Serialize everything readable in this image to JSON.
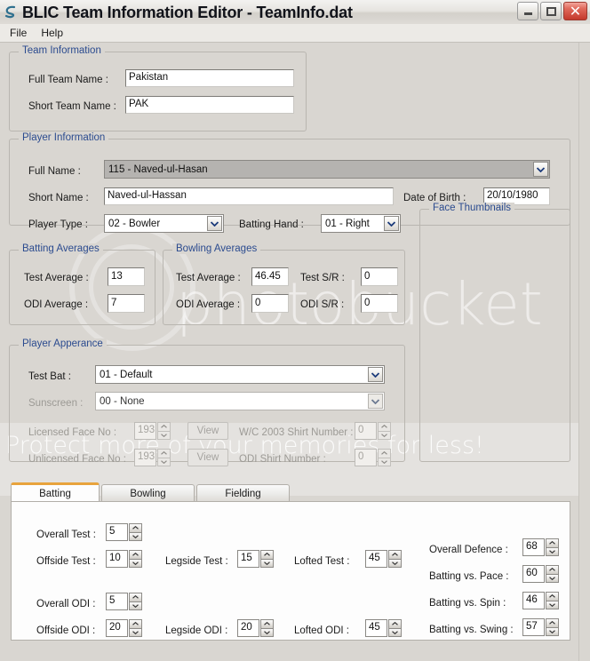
{
  "window": {
    "title": "BLIC Team Information Editor - TeamInfo.dat",
    "minimize_label": "Minimize",
    "maximize_label": "Maximize",
    "close_label": "✕"
  },
  "menu": {
    "items": [
      {
        "label": "File"
      },
      {
        "label": "Help"
      }
    ]
  },
  "team_information": {
    "title": "Team Information",
    "full_team_name_label": "Full Team Name :",
    "full_team_name_value": "Pakistan",
    "short_team_name_label": "Short Team Name :",
    "short_team_name_value": "PAK"
  },
  "player_information": {
    "title": "Player Information",
    "full_name_label": "Full Name :",
    "full_name_value": "115 - Naved-ul-Hasan",
    "short_name_label": "Short Name :",
    "short_name_value": "Naved-ul-Hassan",
    "date_of_birth_label": "Date of Birth :",
    "date_of_birth_value": "20/10/1980",
    "player_type_label": "Player Type :",
    "player_type_value": "02 - Bowler",
    "batting_hand_label": "Batting Hand :",
    "batting_hand_value": "01 - Right",
    "face_thumbnails_title": "Face Thumbnails"
  },
  "batting_averages": {
    "title": "Batting Averages",
    "test_average_label": "Test Average :",
    "test_average_value": "13",
    "odi_average_label": "ODI Average :",
    "odi_average_value": "7"
  },
  "bowling_averages": {
    "title": "Bowling Averages",
    "test_average_label": "Test Average :",
    "test_average_value": "46.45",
    "test_sr_label": "Test S/R :",
    "test_sr_value": "0",
    "odi_average_label": "ODI Average :",
    "odi_average_value": "0",
    "odi_sr_label": "ODI S/R :",
    "odi_sr_value": "0"
  },
  "player_appearance": {
    "title": "Player Apperance",
    "test_bat_label": "Test Bat :",
    "test_bat_value": "01 - Default",
    "sunscreen_label": "Sunscreen :",
    "sunscreen_value": "00 - None",
    "licensed_face_no_label": "Licensed Face No :",
    "licensed_face_no_value": "193",
    "licensed_view_label": "View",
    "unlicensed_face_no_label": "Unlicensed Face No :",
    "unlicensed_face_no_value": "193",
    "unlicensed_view_label": "View",
    "wc2003_shirt_label": "W/C 2003 Shirt Number :",
    "wc2003_shirt_value": "0",
    "odi_shirt_label": "ODI Shirt Number :",
    "odi_shirt_value": "0"
  },
  "skills_tabs": {
    "tabs": [
      {
        "label": "Batting",
        "active": true
      },
      {
        "label": "Bowling",
        "active": false
      },
      {
        "label": "Fielding",
        "active": false
      }
    ]
  },
  "batting_tab": {
    "overall_test_label": "Overall Test :",
    "overall_test_value": "5",
    "offside_test_label": "Offside Test :",
    "offside_test_value": "10",
    "legside_test_label": "Legside Test :",
    "legside_test_value": "15",
    "lofted_test_label": "Lofted Test :",
    "lofted_test_value": "45",
    "overall_odi_label": "Overall ODI :",
    "overall_odi_value": "5",
    "offside_odi_label": "Offside ODI :",
    "offside_odi_value": "20",
    "legside_odi_label": "Legside ODI :",
    "legside_odi_value": "20",
    "lofted_odi_label": "Lofted ODI :",
    "lofted_odi_value": "45",
    "overall_defence_label": "Overall Defence :",
    "overall_defence_value": "68",
    "batting_vs_pace_label": "Batting vs. Pace :",
    "batting_vs_pace_value": "60",
    "batting_vs_spin_label": "Batting vs. Spin :",
    "batting_vs_spin_value": "46",
    "batting_vs_swing_label": "Batting vs. Swing :",
    "batting_vs_swing_value": "57"
  },
  "watermark": {
    "brand_text": "photobucket",
    "tagline_text": "Protect more of your memories for less!"
  },
  "colors": {
    "group_title": "#2b4b8f",
    "active_tab_accent": "#e8a33d",
    "window_face": "#d9d6d1",
    "close_button": "#c4392c"
  }
}
